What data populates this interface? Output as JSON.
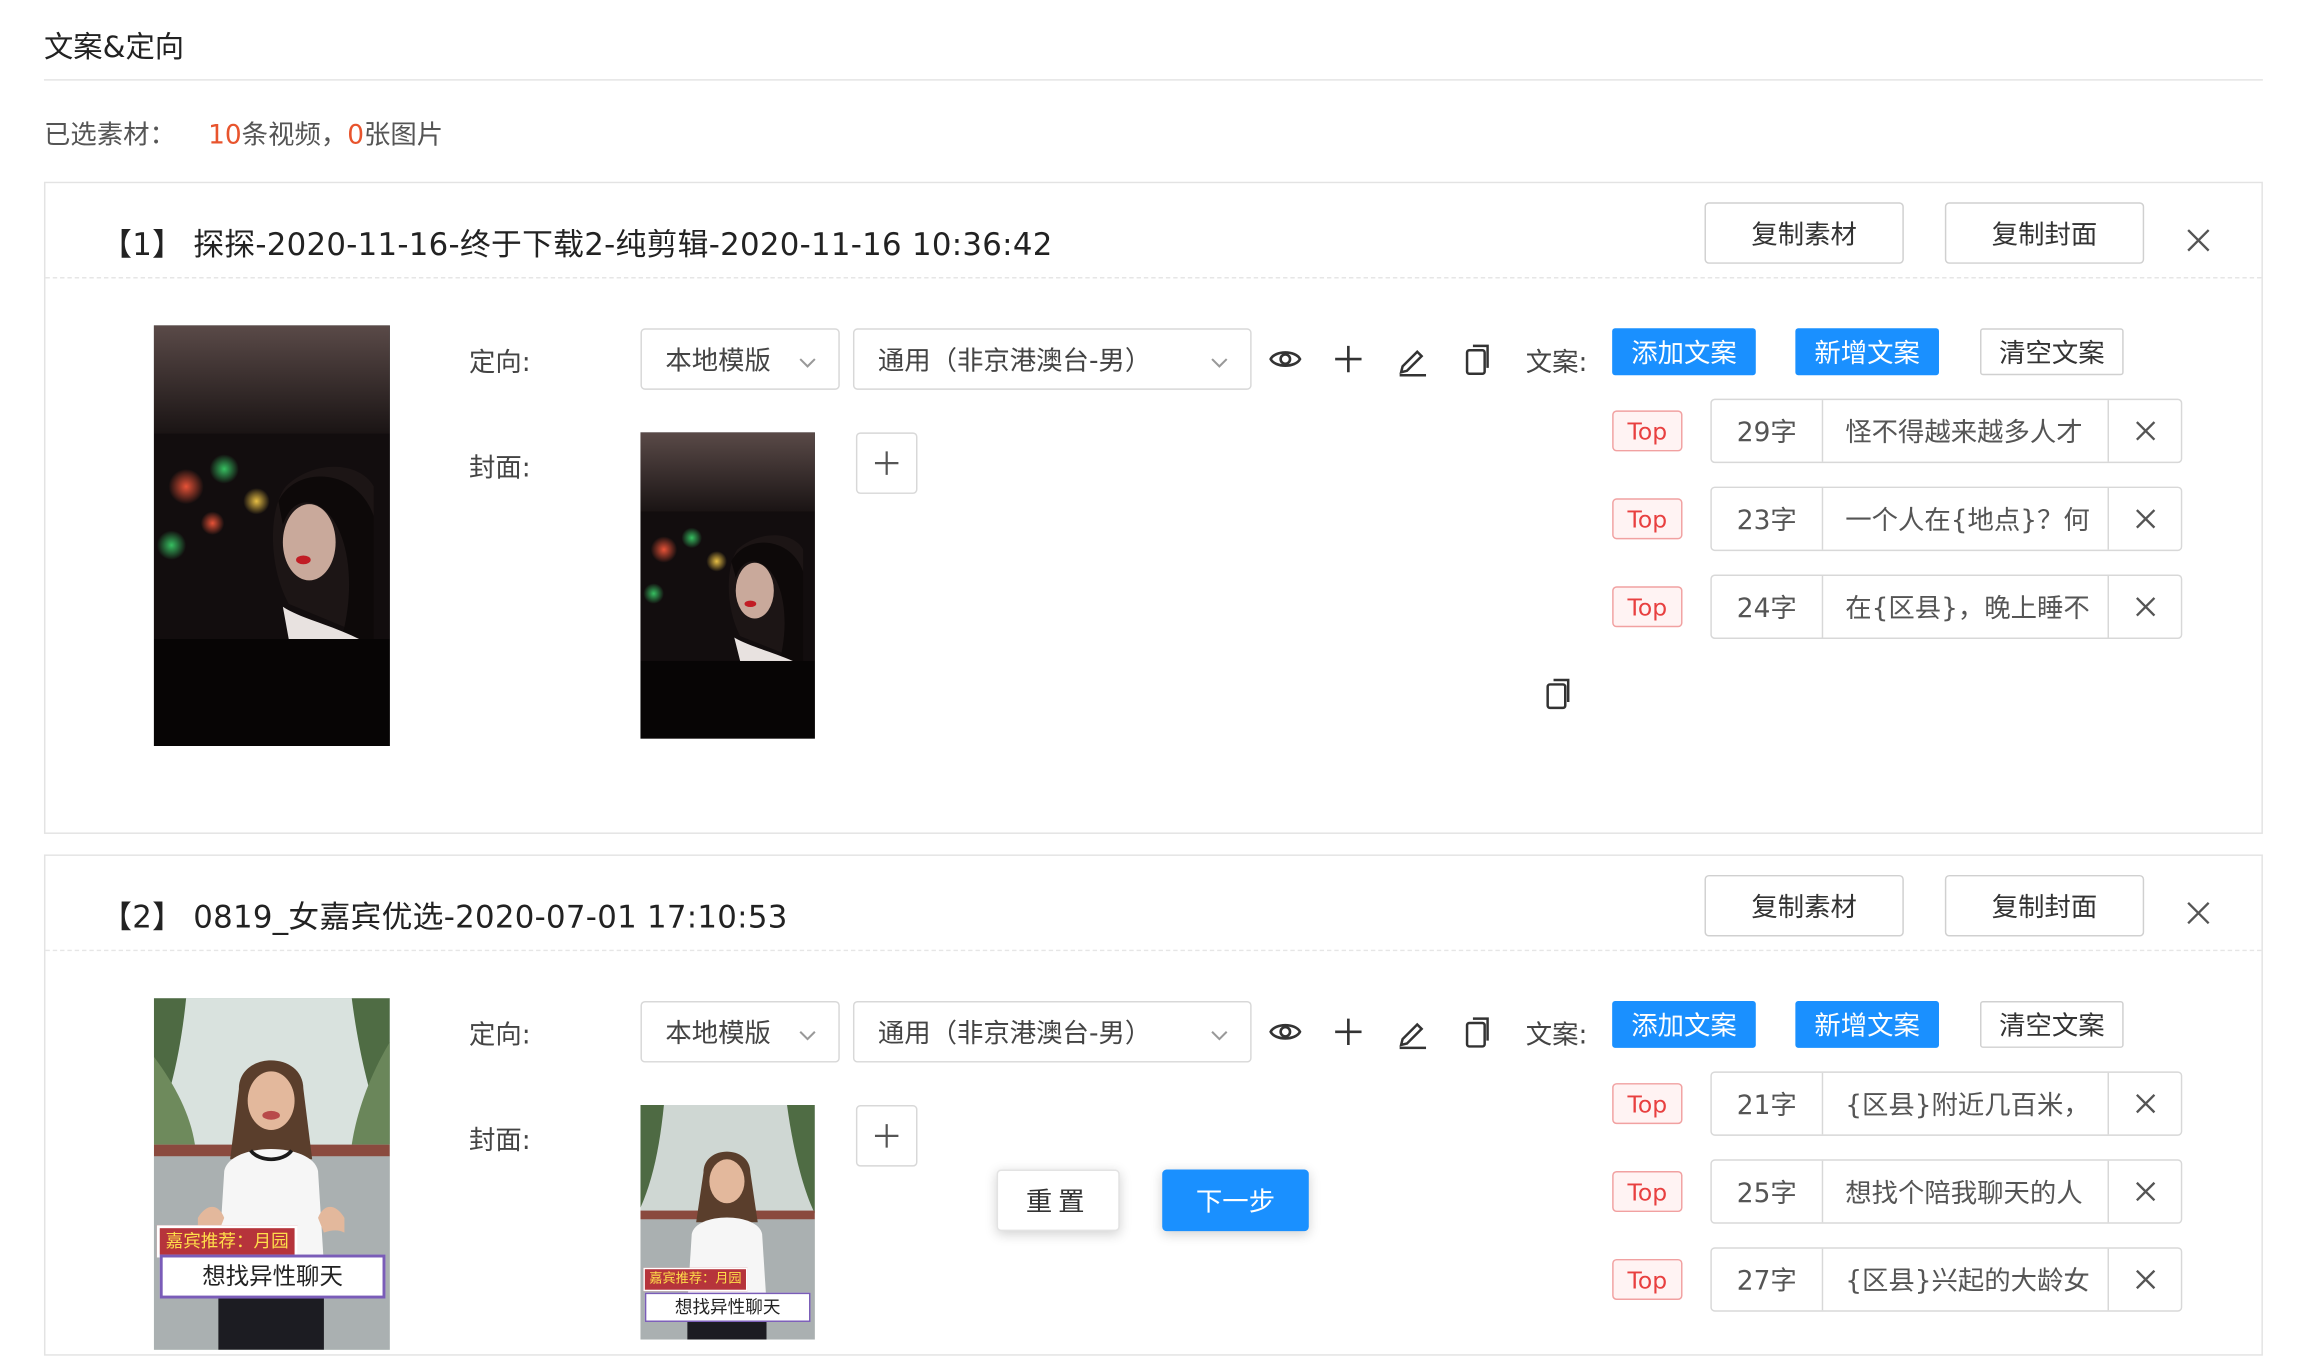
{
  "section_title": "文案&定向",
  "summary": {
    "label": "已选素材：",
    "video_count": "10",
    "video_text": "条视频，",
    "image_count": "0",
    "image_text": "张图片"
  },
  "card_actions": {
    "copy_material": "复制素材",
    "copy_cover": "复制封面"
  },
  "field_labels": {
    "targeting": "定向:",
    "cover": "封面:",
    "copy": "文案:"
  },
  "copy_buttons": {
    "add": "添加文案",
    "new": "新增文案",
    "clear": "清空文案"
  },
  "top_badge": "Top",
  "materials": [
    {
      "title": "【1】 探探-2020-11-16-终于下载2-纯剪辑-2020-11-16 10:36:42",
      "template_select": "本地模版",
      "audience_select": "通用（非京港澳台-男）",
      "copies": [
        {
          "count": "29字",
          "text": "怪不得越来越多人才"
        },
        {
          "count": "23字",
          "text": "一个人在{地点}？何"
        },
        {
          "count": "24字",
          "text": "在{区县}，晚上睡不"
        }
      ]
    },
    {
      "title": "【2】 0819_女嘉宾优选-2020-07-01 17:10:53",
      "template_select": "本地模版",
      "audience_select": "通用（非京港澳台-男）",
      "video_caption_tag": "嘉宾推荐：月园",
      "video_caption": "想找异性聊天",
      "copies": [
        {
          "count": "21字",
          "text": "{区县}附近几百米，"
        },
        {
          "count": "25字",
          "text": "想找个陪我聊天的人"
        },
        {
          "count": "27字",
          "text": "{区县}兴起的大龄女"
        }
      ]
    }
  ],
  "footer": {
    "reset": "重置",
    "next": "下一步"
  }
}
